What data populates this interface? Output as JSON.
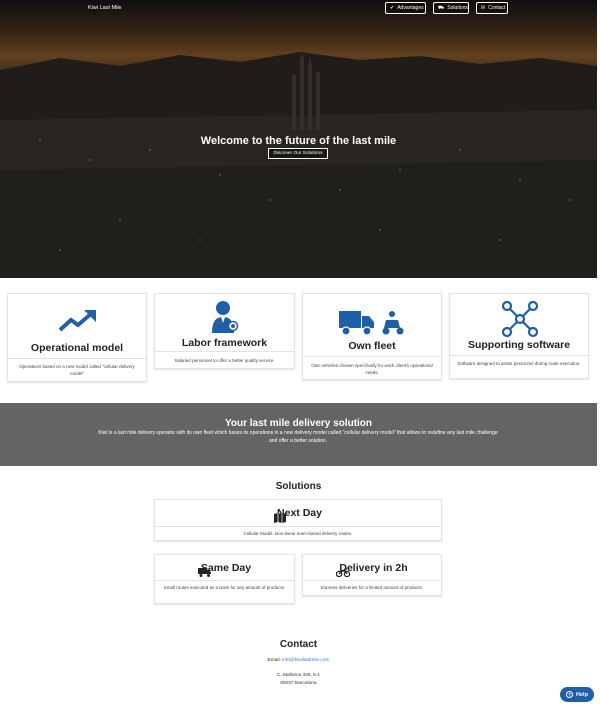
{
  "header": {
    "brand": "Kiwi Last Mile",
    "nav": [
      {
        "label": "Advantages",
        "icon": "check-icon"
      },
      {
        "label": "Solutions",
        "icon": "truck-icon"
      },
      {
        "label": "Contact",
        "icon": "envelope-icon"
      }
    ]
  },
  "hero": {
    "title": "Welcome to the future of the last mile",
    "button": "Discover Our Solutions"
  },
  "advantages": [
    {
      "title": "Operational model",
      "icon": "trend-up-icon",
      "description": "Operations based on a new model called \"cellular delivery model\""
    },
    {
      "title": "Labor framework",
      "icon": "employee-badge-icon",
      "description": "Salaried personnel to offer a better quality service."
    },
    {
      "title": "Own fleet",
      "icon": "truck-scooter-icon",
      "description": "Own vehicles chosen specifically for each client's operational needs."
    },
    {
      "title": "Supporting software",
      "icon": "network-nodes-icon",
      "description": "Software designed to assist personnel during route execution."
    }
  ],
  "mission": {
    "title": "Your last mile delivery solution",
    "text": "Kiwi is a last mile delivery operator with its own fleet which bases its operations in a new delivery model called \"cellular delivery model\" that allows to redefine any last mile challenge and offer a better solution."
  },
  "solutions": {
    "title": "Solutions",
    "items": [
      {
        "title": "Next Day",
        "icon": "map-icon",
        "description": "Cellular Model. Non-linear team-based delivery routes."
      },
      {
        "title": "Same Day",
        "icon": "truck-icon",
        "description": "Small routes executed as a team for any amount of products."
      },
      {
        "title": "Delivery in 2h",
        "icon": "motorcycle-icon",
        "description": "Express deliveries for a limited amount of products."
      }
    ]
  },
  "contact": {
    "title": "Contact",
    "email_label": "Email:",
    "email": "info@kiwilastmile.com",
    "address_line1": "C. Mallorca 336, 5-1",
    "address_line2": "08037 Barcelona"
  },
  "help": {
    "label": "Help",
    "icon": "help-circle-icon"
  },
  "colors": {
    "accent": "#1e5fa8",
    "band": "#646464",
    "link": "#2c7be5"
  }
}
